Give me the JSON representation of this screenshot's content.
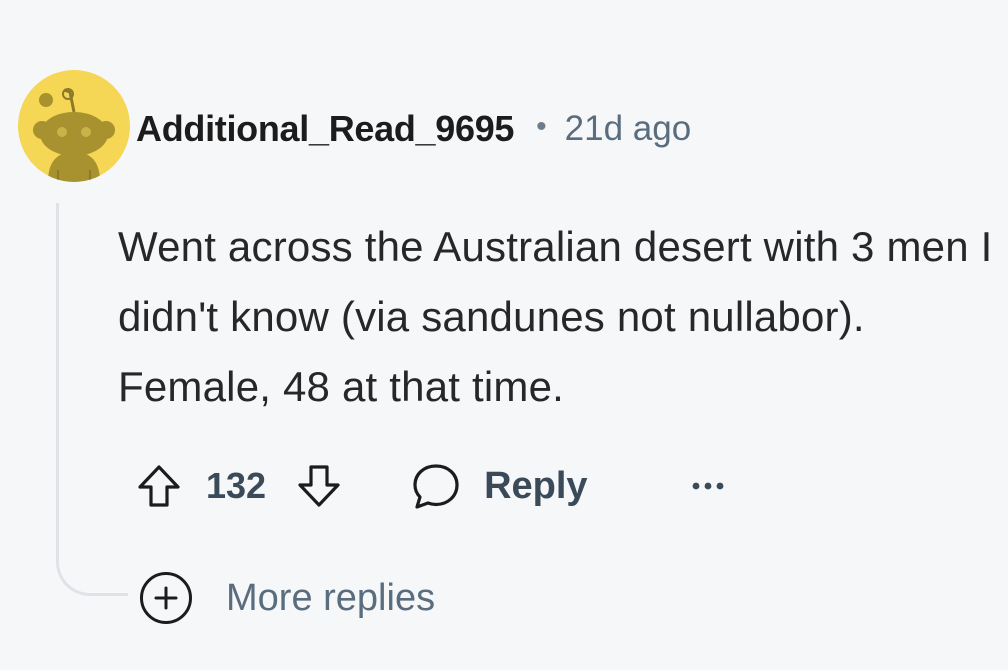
{
  "comment": {
    "author": "Additional_Read_9695",
    "separator": "•",
    "timestamp": "21d ago",
    "body": "Went across the Australian desert with 3 men I didn't know (via sandunes not nullabor). Female, 48 at that time.",
    "score": "132",
    "reply_label": "Reply",
    "more_replies_label": "More replies"
  },
  "icons": {
    "avatar": "snoo-avatar",
    "upvote": "arrow-up-icon",
    "downvote": "arrow-down-icon",
    "reply": "speech-bubble-icon",
    "more": "ellipsis-icon",
    "expand": "plus-circle-icon"
  },
  "colors": {
    "avatar_bg": "#f5d655",
    "avatar_snoo": "#a8922f",
    "text_primary": "#1c1c1c",
    "text_secondary": "#5a6d7f",
    "thread_line": "#dfe3e8",
    "background": "#f6f7f9"
  }
}
